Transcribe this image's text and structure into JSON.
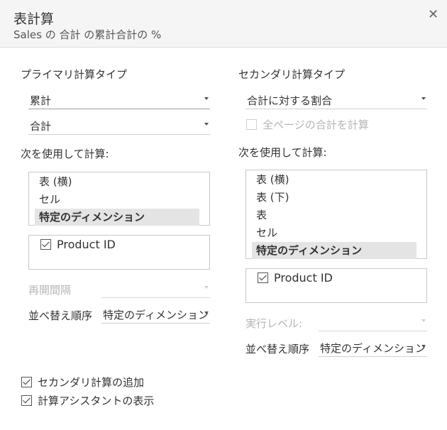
{
  "header": {
    "title": "表計算",
    "subtitle": "Sales の 合計 の累計合計の %",
    "close_label": "✕"
  },
  "primary": {
    "section_label": "プライマリ計算タイプ",
    "calc_type": "累計",
    "aggregation": "合計",
    "compute_using_label": "次を使用して計算:",
    "compute_options": [
      "表 (横)",
      "セル",
      "特定のディメンション"
    ],
    "selected_index": 2,
    "dimension_label": "Product ID",
    "dimension_checked": true,
    "restart_label": "再開間隔",
    "restart_value": "",
    "sort_label": "並べ替え順序",
    "sort_value": "特定のディメンション"
  },
  "secondary": {
    "section_label": "セカンダリ計算タイプ",
    "calc_type": "合計に対する割合",
    "all_pages_label": "全ページの合計を計算",
    "all_pages_checked": false,
    "compute_using_label": "次を使用して計算:",
    "compute_options": [
      "表 (横)",
      "表 (下)",
      "表",
      "セル",
      "特定のディメンション"
    ],
    "selected_index": 4,
    "dimension_label": "Product ID",
    "dimension_checked": true,
    "level_label": "実行レベル:",
    "level_value": "",
    "sort_label": "並べ替え順序",
    "sort_value": "特定のディメンション"
  },
  "footer": {
    "add_secondary_label": "セカンダリ計算の追加",
    "add_secondary_checked": true,
    "show_assistant_label": "計算アシスタントの表示",
    "show_assistant_checked": true
  }
}
